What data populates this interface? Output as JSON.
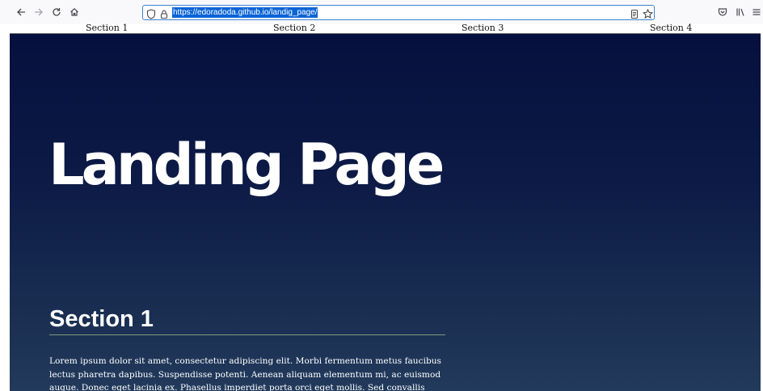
{
  "browser": {
    "url": "https://edoradoda.github.io/landig_page/",
    "icons": {
      "back": "arrow-left-icon",
      "forward": "arrow-right-icon",
      "reload": "reload-icon",
      "home": "home-icon",
      "tracking": "shield-icon",
      "lock": "lock-icon",
      "reader": "reader-view-icon",
      "bookmark": "star-icon",
      "pocket": "pocket-icon",
      "library": "library-icon",
      "menu": "hamburger-menu-icon"
    },
    "accent_color": "#0a64d6"
  },
  "nav": {
    "links": [
      "Section 1",
      "Section 2",
      "Section 3",
      "Section 4"
    ]
  },
  "hero": {
    "title": "Landing Page",
    "gradient_top": "#06103e",
    "gradient_bottom": "#223a5c"
  },
  "section1": {
    "title": "Section 1",
    "text": "Lorem ipsum dolor sit amet, consectetur adipiscing elit. Morbi fermentum metus faucibus lectus pharetra dapibus. Suspendisse potenti. Aenean aliquam elementum mi, ac euismod augue. Donec eget lacinia ex. Phasellus imperdiet porta orci eget mollis. Sed convallis sollicitudin mauris ac tincidunt."
  }
}
